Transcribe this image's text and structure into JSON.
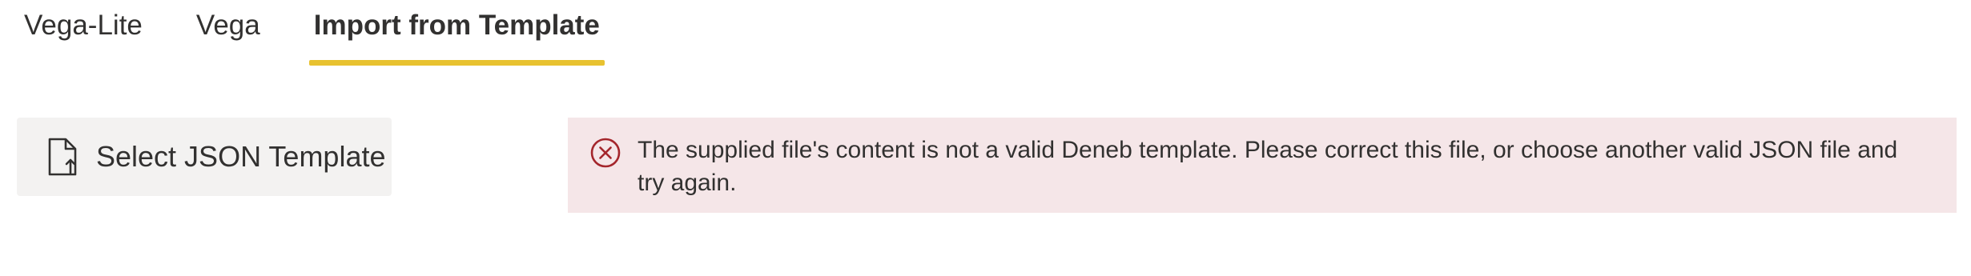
{
  "tabs": [
    {
      "label": "Vega-Lite",
      "active": false
    },
    {
      "label": "Vega",
      "active": false
    },
    {
      "label": "Import from Template",
      "active": true
    }
  ],
  "select_button": {
    "label": "Select JSON Template",
    "icon": "file-upload-icon"
  },
  "error": {
    "icon": "error-circle-icon",
    "message": "The supplied file's content is not a valid Deneb template. Please correct this file, or choose another valid JSON file and try again."
  },
  "colors": {
    "active_tab_underline": "#e8c230",
    "error_background": "#f5e6e8",
    "error_icon": "#a4262c",
    "button_background": "#f3f2f1"
  }
}
